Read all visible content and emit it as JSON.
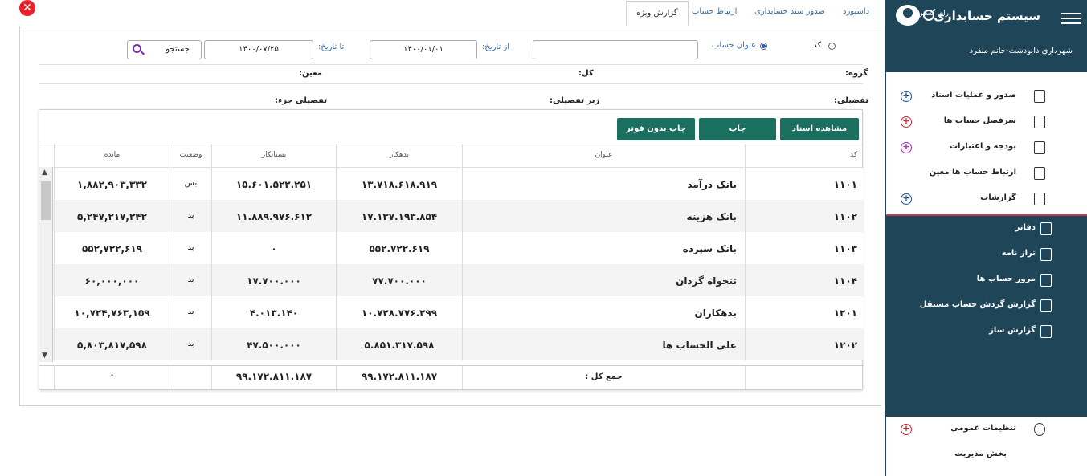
{
  "window": {
    "close_icon": "close-icon"
  },
  "tabs": [
    {
      "label": "داشبورد"
    },
    {
      "label": "صدور سند حسابداری"
    },
    {
      "label": "ارتباط حساب"
    },
    {
      "label": "گزارش ویژه"
    }
  ],
  "search": {
    "radio_code": "کد",
    "radio_title": "عنوان حساب",
    "title_value": "",
    "from_label": "از تاریخ:",
    "from_value": "۱۴۰۰/۰۱/۰۱",
    "to_label": "تا تاریخ:",
    "to_value": "۱۴۰۰/۰۷/۲۵",
    "search_button": "جستجو"
  },
  "info": {
    "group": "گروه:",
    "kol": "کل:",
    "moein": "معین:",
    "tafsili": "تفضیلی:",
    "zir_tafsili": "زیر تفضیلی:",
    "tafsili_joz": "تفضیلی جزء:"
  },
  "toolbar": {
    "view_docs": "مشاهده اسناد",
    "print": "چاپ",
    "print_no_footer": "چاپ بدون فوتر"
  },
  "table": {
    "columns": [
      "کد",
      "عنوان",
      "بدهکار",
      "بستانکار",
      "وضعیت",
      "مانده"
    ],
    "rows": [
      [
        "۱۱۰۱",
        "بانک درآمد",
        "۱۳.۷۱۸.۶۱۸.۹۱۹",
        "۱۵.۶۰۱.۵۲۲.۲۵۱",
        "بس",
        "۱,۸۸۲,۹۰۳,۳۳۲"
      ],
      [
        "۱۱۰۲",
        "بانک هزینه",
        "۱۷.۱۳۷.۱۹۳.۸۵۴",
        "۱۱.۸۸۹.۹۷۶.۶۱۲",
        "بد",
        "۵,۲۴۷,۲۱۷,۲۴۲"
      ],
      [
        "۱۱۰۳",
        "بانک سپرده",
        "۵۵۲.۷۲۲.۶۱۹",
        "۰",
        "بد",
        "۵۵۲,۷۲۲,۶۱۹"
      ],
      [
        "۱۱۰۴",
        "تنخواه گردان",
        "۷۷.۷۰۰.۰۰۰",
        "۱۷.۷۰۰.۰۰۰",
        "بد",
        "۶۰,۰۰۰,۰۰۰"
      ],
      [
        "۱۲۰۱",
        "بدهکاران",
        "۱۰.۷۲۸.۷۷۶.۲۹۹",
        "۴.۰۱۳.۱۴۰",
        "بد",
        "۱۰,۷۲۴,۷۶۳,۱۵۹"
      ],
      [
        "۱۲۰۲",
        "علی الحساب ها",
        "۵.۸۵۱.۳۱۷.۵۹۸",
        "۴۷.۵۰۰.۰۰۰",
        "بد",
        "۵,۸۰۳,۸۱۷,۵۹۸"
      ]
    ],
    "total_label": "جمع کل :",
    "total_debit": "۹۹.۱۷۲.۸۱۱.۱۸۷",
    "total_credit": "۹۹.۱۷۲.۸۱۱.۱۸۷",
    "total_balance": "۰"
  },
  "sidebar": {
    "title": "سیستم حسابداری",
    "subtitle": "رای گستر",
    "org": "شهرداری دابودشت-خانم منفرد",
    "items": [
      {
        "label": "صدور و عملیات اسناد",
        "plus_color": "#1f4e9a"
      },
      {
        "label": "سرفصل حساب ها",
        "plus_color": "#d0202f"
      },
      {
        "label": "بودجه و اعتبارات",
        "plus_color": "#a12db8"
      },
      {
        "label": "ارتباط حساب ها معین",
        "plus_color": ""
      },
      {
        "label": "گزارشات",
        "plus_color": "#1f4e9a"
      }
    ],
    "sub_items": [
      {
        "label": "دفاتر"
      },
      {
        "label": "تراز نامه"
      },
      {
        "label": "مرور حساب ها"
      },
      {
        "label": "گزارش گردش حساب مستقل"
      },
      {
        "label": "گزارش ساز"
      }
    ],
    "settings": "تنظیمات عمومی",
    "admin": "بخش مدیریت",
    "colors": {
      "header_bg": "#1f4658",
      "accent_button": "#1a6f5e"
    }
  }
}
